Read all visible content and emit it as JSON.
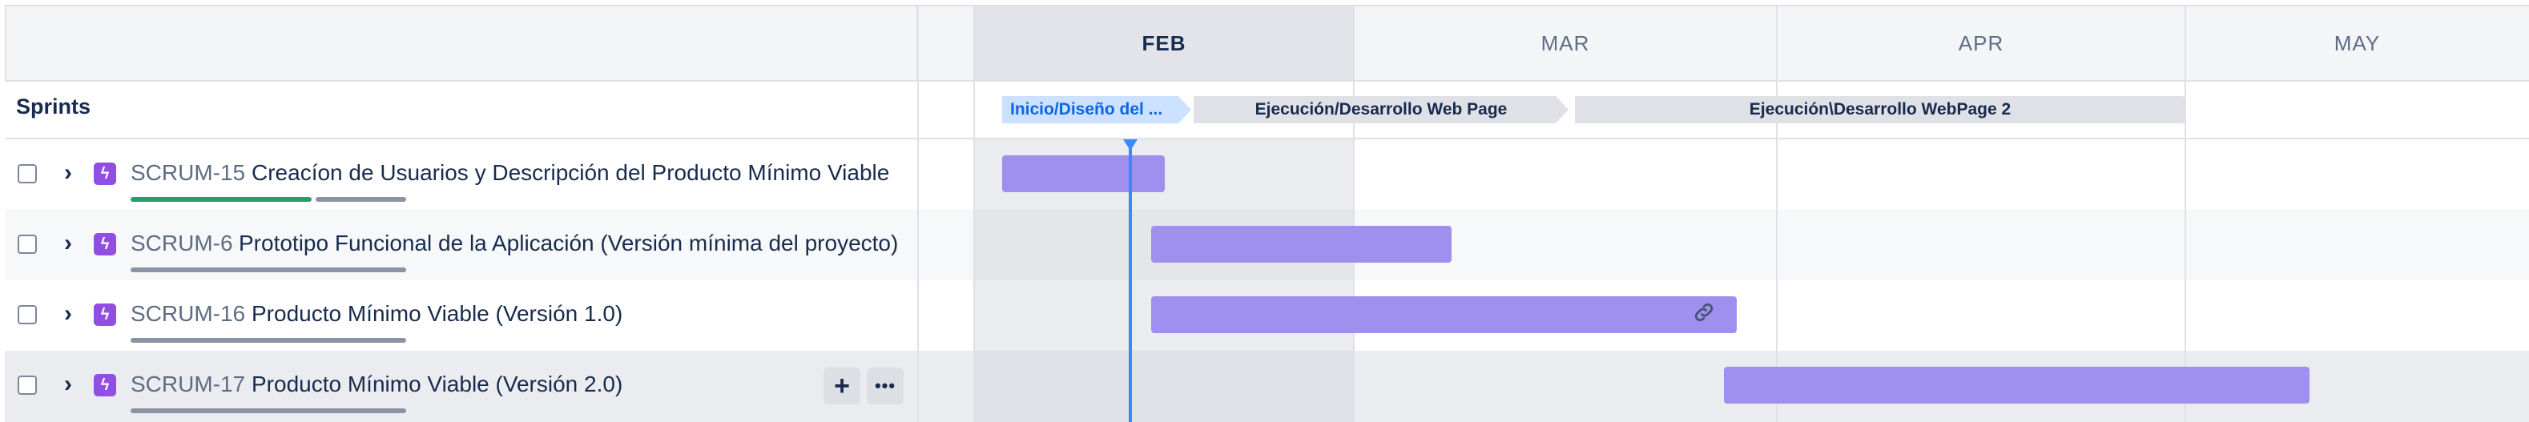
{
  "timeline": {
    "months": [
      {
        "label": "FEB",
        "current": true
      },
      {
        "label": "MAR",
        "current": false
      },
      {
        "label": "APR",
        "current": false
      },
      {
        "label": "MAY",
        "current": false
      }
    ]
  },
  "sprints": {
    "label": "Sprints",
    "items": [
      {
        "label": "Inicio/Diseño del ...",
        "state": "active"
      },
      {
        "label": "Ejecución/Desarrollo Web Page",
        "state": "future"
      },
      {
        "label": "Ejecución\\Desarrollo WebPage 2",
        "state": "future"
      }
    ]
  },
  "issues": [
    {
      "key": "SCRUM-15",
      "title": "Creacíon de Usuarios y Descripción del Producto Mínimo Viable",
      "progress_done": 0.67,
      "icon": "epic-lightning-icon"
    },
    {
      "key": "SCRUM-6",
      "title": "Prototipo Funcional de la Aplicación (Versión mínima del proyecto)",
      "progress_done": 0,
      "icon": "epic-lightning-icon"
    },
    {
      "key": "SCRUM-16",
      "title": "Producto Mínimo Viable (Versión 1.0)",
      "progress_done": 0,
      "icon": "epic-lightning-icon",
      "has_dependency_link": true
    },
    {
      "key": "SCRUM-17",
      "title": "Producto Mínimo Viable (Versión 2.0)",
      "progress_done": 0,
      "icon": "epic-lightning-icon",
      "hovered": true
    }
  ],
  "row_actions": {
    "add": "+",
    "more": "•••"
  },
  "colors": {
    "bar": "#9f8fef",
    "today_marker": "#388bff",
    "progress_done": "#22a06b",
    "progress_todo": "#8993a4",
    "epic_icon": "#904ee2",
    "active_sprint_bg": "#cce0ff",
    "active_sprint_text": "#0c66e4"
  }
}
